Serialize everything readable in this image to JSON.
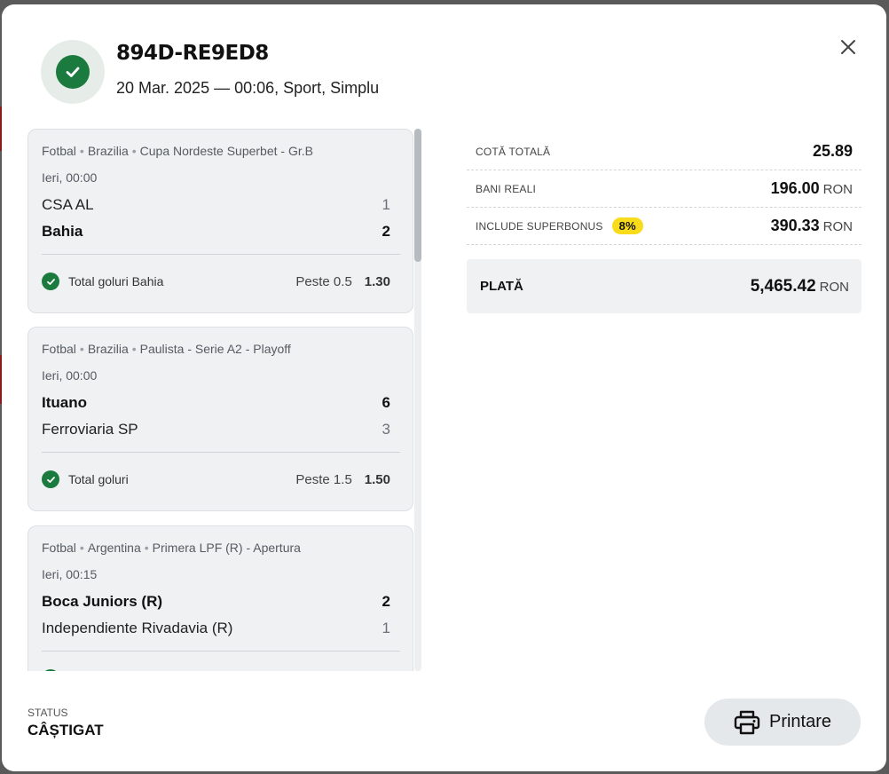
{
  "ticket": {
    "id": "894D-RE9ED8",
    "meta": "20 Mar. 2025 — 00:06, Sport, Simplu"
  },
  "events": [
    {
      "sport": "Fotbal",
      "country": "Brazilia",
      "competition": "Cupa Nordeste Superbet - Gr.B",
      "time": "Ieri, 00:00",
      "home": {
        "name": "CSA AL",
        "score": "1"
      },
      "away": {
        "name": "Bahia",
        "score": "2"
      },
      "selection": {
        "market": "Total goluri Bahia",
        "pick": "Peste 0.5",
        "odd": "1.30"
      }
    },
    {
      "sport": "Fotbal",
      "country": "Brazilia",
      "competition": "Paulista - Serie A2 - Playoff",
      "time": "Ieri, 00:00",
      "home": {
        "name": "Ituano",
        "score": "6"
      },
      "away": {
        "name": "Ferroviaria SP",
        "score": "3"
      },
      "selection": {
        "market": "Total goluri",
        "pick": "Peste 1.5",
        "odd": "1.50"
      }
    },
    {
      "sport": "Fotbal",
      "country": "Argentina",
      "competition": "Primera LPF (R) - Apertura",
      "time": "Ieri, 00:15",
      "home": {
        "name": "Boca Juniors (R)",
        "score": "2"
      },
      "away": {
        "name": "Independiente Rivadavia (R)",
        "score": "1"
      },
      "selection": {
        "market": "",
        "pick": "",
        "odd": ""
      }
    }
  ],
  "summary": {
    "total_odds": {
      "label": "COTĂ TOTALĂ",
      "value": "25.89"
    },
    "real_money": {
      "label": "BANI REALI",
      "value": "196.00",
      "currency": "RON"
    },
    "superbonus": {
      "label": "INCLUDE SUPERBONUS",
      "pill": "8%",
      "value": "390.33",
      "currency": "RON"
    },
    "payout": {
      "label": "PLATĂ",
      "value": "5,465.42",
      "currency": "RON"
    }
  },
  "status": {
    "label": "STATUS",
    "value": "CÂȘTIGAT"
  },
  "print_button": {
    "label": "Printare"
  },
  "colors": {
    "win_green": "#1b7a3e",
    "bonus_yellow": "#f8dc1b"
  },
  "icons": {
    "header": "check-circle-icon",
    "close": "close-icon",
    "print": "printer-icon"
  }
}
